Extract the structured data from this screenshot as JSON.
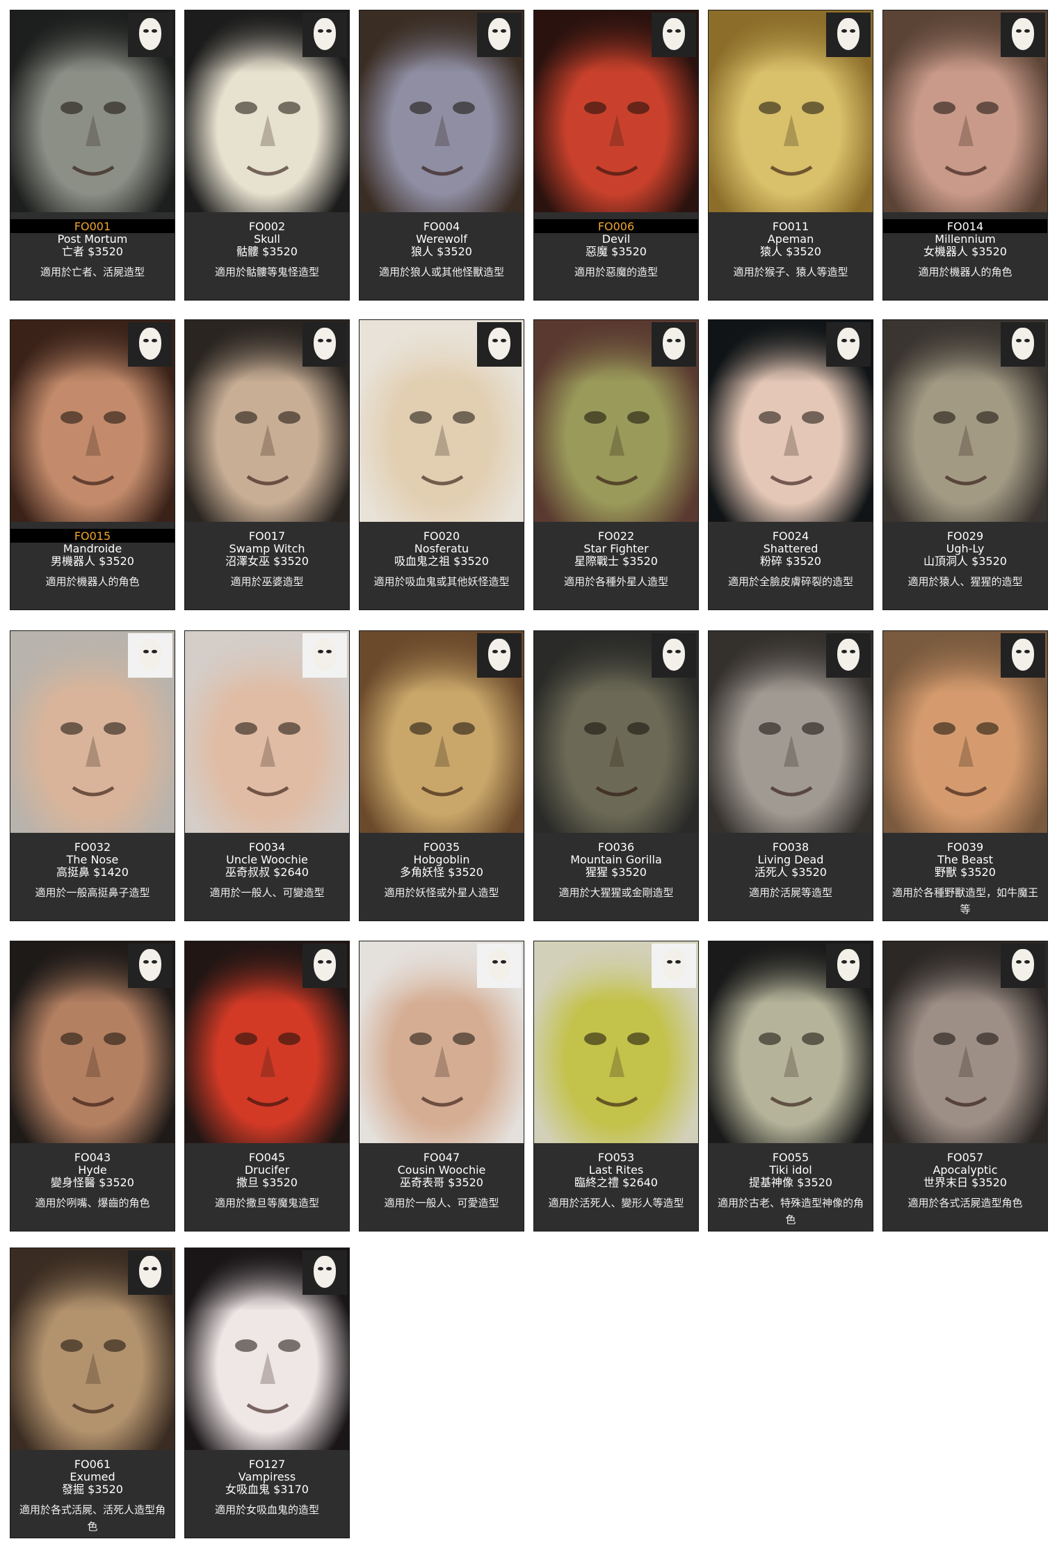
{
  "products": [
    {
      "code": "FO001",
      "name": "Post Mortum",
      "price_line": "亡者 $3520",
      "desc": "適用於亡者、活屍造型",
      "face": "#8c8f86",
      "bg": "#1d1f1e"
    },
    {
      "code": "FO002",
      "name": "Skull",
      "price_line": "骷髏 $3520",
      "desc": "適用於骷髏等鬼怪造型",
      "face": "#e7e1cf",
      "bg": "#1c1c1c"
    },
    {
      "code": "FO004",
      "name": "Werewolf",
      "price_line": "狼人 $3520",
      "desc": "適用於狼人或其他怪獸造型",
      "face": "#8f8ea3",
      "bg": "#3a2d24"
    },
    {
      "code": "FO006",
      "name": "Devil",
      "price_line": "惡魔 $3520",
      "desc": "適用於惡魔的造型",
      "face": "#c9412c",
      "bg": "#2a120e"
    },
    {
      "code": "FO011",
      "name": "Apeman",
      "price_line": "猿人 $3520",
      "desc": "適用於猴子、猿人等造型",
      "face": "#d9c06a",
      "bg": "#8c6e2a"
    },
    {
      "code": "FO014",
      "name": "Millennium",
      "price_line": "女機器人 $3520",
      "desc": "適用於機器人的角色",
      "face": "#c99a8a",
      "bg": "#5b4436"
    },
    {
      "code": "FO015",
      "name": "Mandroide",
      "price_line": "男機器人 $3520",
      "desc": "適用於機器人的角色",
      "face": "#c38b6b",
      "bg": "#3a2219"
    },
    {
      "code": "FO017",
      "name": "Swamp Witch",
      "price_line": "沼澤女巫 $3520",
      "desc": "適用於巫婆造型",
      "face": "#c8ae95",
      "bg": "#2a2521"
    },
    {
      "code": "FO020",
      "name": "Nosferatu",
      "price_line": "吸血鬼之祖 $3520",
      "desc": "適用於吸血鬼或其他妖怪造型",
      "face": "#e2cfb2",
      "bg": "#e8e2d8"
    },
    {
      "code": "FO022",
      "name": "Star Fighter",
      "price_line": "星際戰士 $3520",
      "desc": "適用於各種外星人造型",
      "face": "#9a9a5a",
      "bg": "#5a3a30"
    },
    {
      "code": "FO024",
      "name": "Shattered",
      "price_line": "粉碎 $3520",
      "desc": "適用於全臉皮膚碎裂的造型",
      "face": "#e4c7b6",
      "bg": "#101416"
    },
    {
      "code": "FO029",
      "name": "Ugh-Ly",
      "price_line": "山頂洞人 $3520",
      "desc": "適用於猿人、猩猩的造型",
      "face": "#a39a84",
      "bg": "#3a3530"
    },
    {
      "code": "FO032",
      "name": "The Nose",
      "price_line": "高挺鼻 $1420",
      "desc": "適用於一般高挺鼻子造型",
      "face": "#d9b49a",
      "bg": "#b8b3ac"
    },
    {
      "code": "FO034",
      "name": "Uncle Woochie",
      "price_line": "巫奇叔叔 $2640",
      "desc": "適用於一般人、可變造型",
      "face": "#e0bca4",
      "bg": "#d4cdc8"
    },
    {
      "code": "FO035",
      "name": "Hobgoblin",
      "price_line": "多角妖怪 $3520",
      "desc": "適用於妖怪或外星人造型",
      "face": "#c9a76a",
      "bg": "#6b4a2c"
    },
    {
      "code": "FO036",
      "name": "Mountain Gorilla",
      "price_line": "猩猩 $3520",
      "desc": "適用於大猩猩或金剛造型",
      "face": "#6c6a56",
      "bg": "#2a2a28"
    },
    {
      "code": "FO038",
      "name": "Living Dead",
      "price_line": "活死人 $3520",
      "desc": "適用於活屍等造型",
      "face": "#a09a92",
      "bg": "#34302c"
    },
    {
      "code": "FO039",
      "name": "The Beast",
      "price_line": "野獸 $3520",
      "desc": "適用於各種野獸造型，如牛魔王等",
      "face": "#d59b6e",
      "bg": "#7a5a3e"
    },
    {
      "code": "FO043",
      "name": "Hyde",
      "price_line": "變身怪醫 $3520",
      "desc": "適用於咧嘴、爆齒的角色",
      "face": "#b48062",
      "bg": "#1e1a18"
    },
    {
      "code": "FO045",
      "name": "Drucifer",
      "price_line": "撒旦 $3520",
      "desc": "適用於撒旦等魔鬼造型",
      "face": "#d23a26",
      "bg": "#221614"
    },
    {
      "code": "FO047",
      "name": "Cousin Woochie",
      "price_line": "巫奇表哥 $3520",
      "desc": "適用於一般人、可愛造型",
      "face": "#d5ad93",
      "bg": "#e4e0dc"
    },
    {
      "code": "FO053",
      "name": "Last Rites",
      "price_line": "臨終之禮 $2640",
      "desc": "適用於活死人、變形人等造型",
      "face": "#c3c24a",
      "bg": "#d2d0b8"
    },
    {
      "code": "FO055",
      "name": "Tiki idol",
      "price_line": "提基神像 $3520",
      "desc": "適用於古老、特殊造型神像的角色",
      "face": "#b5b49a",
      "bg": "#1a1a1a"
    },
    {
      "code": "FO057",
      "name": "Apocalyptic",
      "price_line": "世界末日 $3520",
      "desc": "適用於各式活屍造型角色",
      "face": "#9e8f86",
      "bg": "#2c2826"
    },
    {
      "code": "FO061",
      "name": "Exumed",
      "price_line": "發掘 $3520",
      "desc": "適用於各式活屍、活死人造型角色",
      "face": "#b3936e",
      "bg": "#3a2c22"
    },
    {
      "code": "FO127",
      "name": "Vampiress",
      "price_line": "女吸血鬼 $3170",
      "desc": "適用於女吸血鬼的造型",
      "face": "#efe6e6",
      "bg": "#1a1618"
    }
  ],
  "colors": {
    "card_bg": "#2e2e2e",
    "text": "#ffffff",
    "highlight_code": "#f2a52e"
  }
}
